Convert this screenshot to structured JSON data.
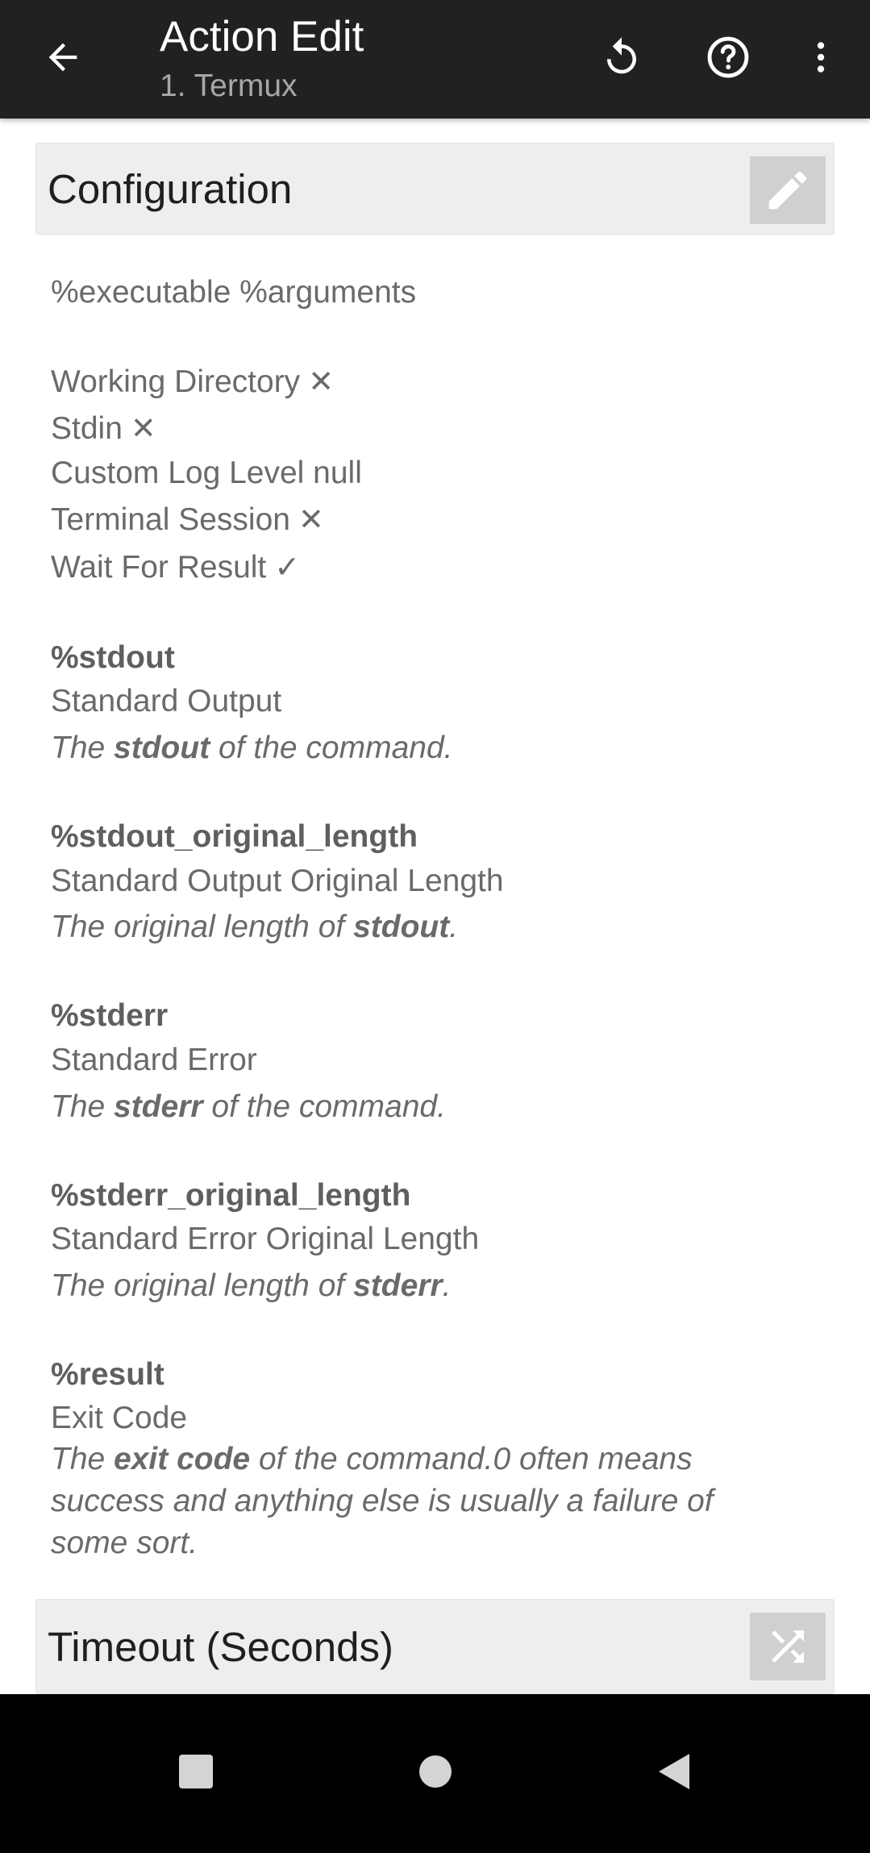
{
  "topbar": {
    "back_icon": "arrow-left-icon",
    "title": "Action Edit",
    "subtitle": "1. Termux",
    "undo_icon": "undo-icon",
    "help_icon": "help-circle-icon",
    "more_icon": "more-vert-icon"
  },
  "configuration": {
    "header": "Configuration",
    "edit_icon": "pencil-icon",
    "command": "%executable %arguments",
    "options": [
      {
        "label": "Working Directory",
        "mark": "✕"
      },
      {
        "label": "Stdin",
        "mark": "✕"
      },
      {
        "label": "Custom Log Level null",
        "mark": ""
      },
      {
        "label": "Terminal Session",
        "mark": "✕"
      },
      {
        "label": "Wait For Result",
        "mark": "✓"
      }
    ],
    "variables": [
      {
        "name": "%stdout",
        "title": "Standard Output",
        "desc_pre": "The ",
        "desc_bold": "stdout",
        "desc_post": " of the command."
      },
      {
        "name": "%stdout_original_length",
        "title": "Standard Output Original Length",
        "desc_pre": "The original length of ",
        "desc_bold": "stdout",
        "desc_post": "."
      },
      {
        "name": "%stderr",
        "title": "Standard Error",
        "desc_pre": "The ",
        "desc_bold": "stderr",
        "desc_post": " of the command."
      },
      {
        "name": "%stderr_original_length",
        "title": "Standard Error Original Length",
        "desc_pre": "The original length of ",
        "desc_bold": "stderr",
        "desc_post": "."
      },
      {
        "name": "%result",
        "title": "Exit Code",
        "desc_pre": "The ",
        "desc_bold": "exit code",
        "desc_post": " of the command.0 often means",
        "desc_line2": "success and anything else is usually a failure of",
        "desc_line3": "some sort."
      }
    ]
  },
  "timeout": {
    "header": "Timeout (Seconds)",
    "action_icon": "shuffle-icon"
  },
  "navbar": {
    "recents_icon": "square-icon",
    "home_icon": "circle-icon",
    "back_icon": "triangle-back-icon"
  }
}
